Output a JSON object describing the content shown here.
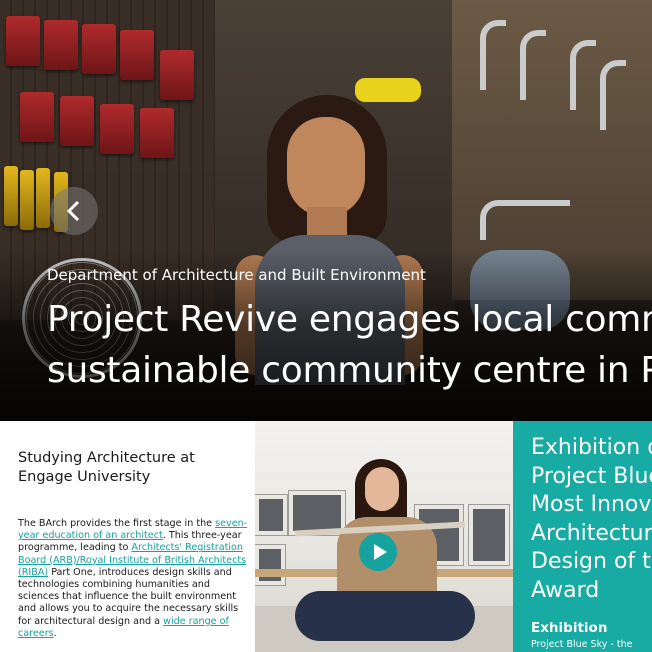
{
  "hero": {
    "department": "Department of Architecture and Built Environment",
    "headline_line1": "Project Revive engages local commun",
    "headline_line2": "sustainable community centre in Parit",
    "prev_icon": "chevron-left-icon"
  },
  "card_study": {
    "title": "Studying Architecture at Engage University",
    "p1": "The BArch provides the first stage in the ",
    "link1": "seven-year education of an architect",
    "p2": ". This three-year programme, leading to ",
    "link2": "Architects' Registration Board (ARB)/Royal Institute of British Architects (RIBA)",
    "p3": " Part One, introduces design skills and technologies combining humanities and sciences that influence the built environment and allows you to acquire the necessary skills for architectural design and a ",
    "link3": "wide range of careers",
    "p4": ".",
    "link_color": "#16a29e"
  },
  "card_video": {
    "play_icon": "play-icon",
    "accent": "#16a29e"
  },
  "card_exhibition": {
    "title_line1": "Exhibition o",
    "title_line2": "Project Blue",
    "title_line3": "Most Innova",
    "title_line4": "Architectur",
    "title_line5": "Design of th",
    "title_line6": "Award",
    "tag": "Exhibition",
    "subtitle": "Project Blue Sky - the",
    "bg": "#17aba3"
  }
}
